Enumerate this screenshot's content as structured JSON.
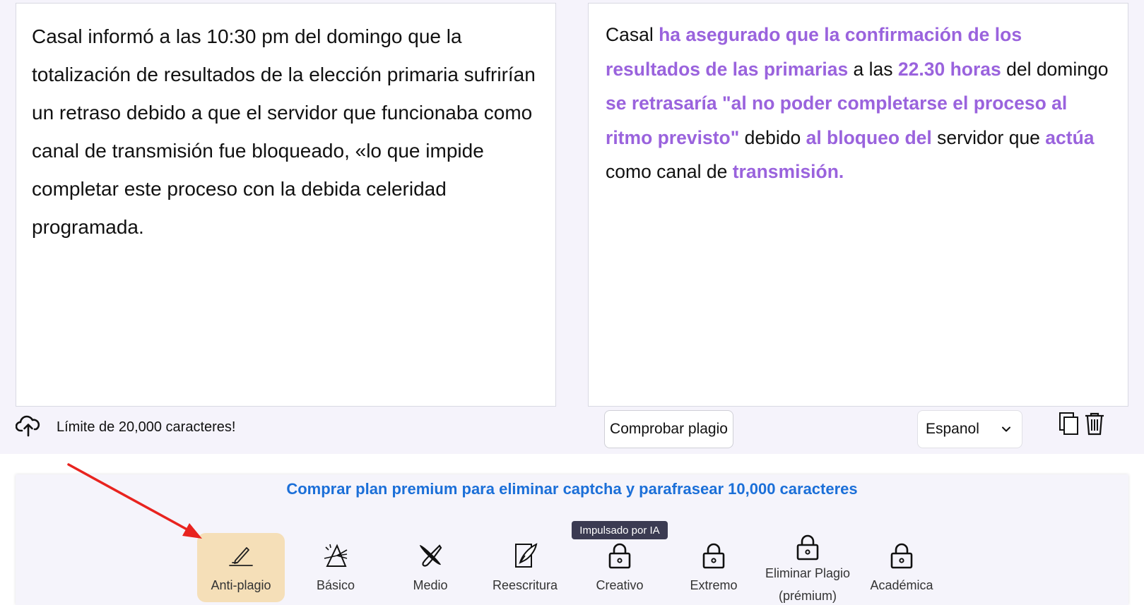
{
  "input": {
    "text": "Casal informó a las 10:30 pm del domingo que la totalización de resultados de la elección primaria sufrirían un retraso debido a que el servidor que funcionaba como canal de transmisión fue bloqueado, «lo que impide completar este proceso con la debida celeridad programada.",
    "limit_label": "Límite de 20,000 caracteres!"
  },
  "output": {
    "segments": [
      {
        "text": "Casal ",
        "changed": false
      },
      {
        "text": "ha asegurado que la confirmación de los resultados de las primarias",
        "changed": true
      },
      {
        "text": " a las ",
        "changed": false
      },
      {
        "text": "22.30 horas",
        "changed": true
      },
      {
        "text": " del domingo ",
        "changed": false
      },
      {
        "text": "se retrasaría \"al no poder completarse el proceso al ritmo previsto\"",
        "changed": true
      },
      {
        "text": " debido ",
        "changed": false
      },
      {
        "text": "al bloqueo del",
        "changed": true
      },
      {
        "text": " servidor que ",
        "changed": false
      },
      {
        "text": "actúa",
        "changed": true
      },
      {
        "text": " como canal de ",
        "changed": false
      },
      {
        "text": "transmisión.",
        "changed": true
      }
    ]
  },
  "toolbar": {
    "check_plagiarism_label": "Comprobar plagio",
    "language_selected": "Espanol"
  },
  "promo": {
    "text": "Comprar plan premium para eliminar captcha y parafrasear 10,000 caracteres"
  },
  "tooltip": {
    "text": "Impulsado por IA"
  },
  "modes": [
    {
      "label": "Anti-plagio",
      "icon": "pen-icon",
      "active": true
    },
    {
      "label": "Básico",
      "icon": "prism-icon",
      "active": false
    },
    {
      "label": "Medio",
      "icon": "brush-icon",
      "active": false
    },
    {
      "label": "Reescritura",
      "icon": "quill-icon",
      "active": false
    },
    {
      "label": "Creativo",
      "icon": "lock-icon",
      "active": false
    },
    {
      "label": "Extremo",
      "icon": "lock-icon",
      "active": false
    },
    {
      "label": "Eliminar Plagio",
      "label2": "(prémium)",
      "icon": "lock-icon",
      "active": false
    },
    {
      "label": "Académica",
      "icon": "lock-icon",
      "active": false
    }
  ],
  "colors": {
    "highlight": "#9a63dd",
    "promo": "#1b6fd8",
    "active_mode": "#f5dfb8",
    "arrow": "#e8231f"
  }
}
